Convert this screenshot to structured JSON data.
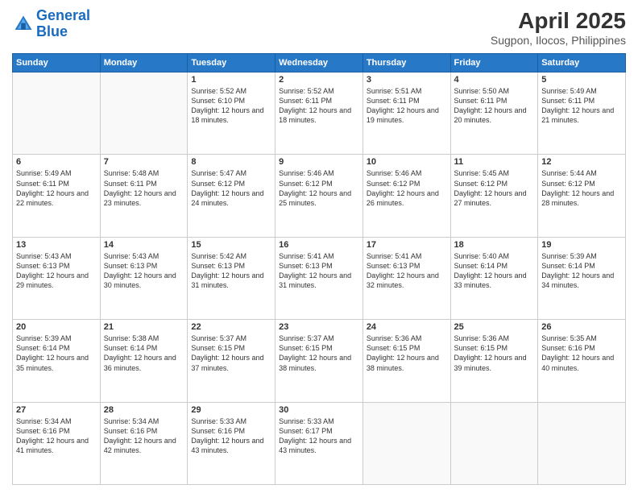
{
  "header": {
    "logo_line1": "General",
    "logo_line2": "Blue",
    "title": "April 2025",
    "subtitle": "Sugpon, Ilocos, Philippines"
  },
  "calendar": {
    "days_of_week": [
      "Sunday",
      "Monday",
      "Tuesday",
      "Wednesday",
      "Thursday",
      "Friday",
      "Saturday"
    ],
    "weeks": [
      [
        {
          "day": "",
          "sunrise": "",
          "sunset": "",
          "daylight": ""
        },
        {
          "day": "",
          "sunrise": "",
          "sunset": "",
          "daylight": ""
        },
        {
          "day": "1",
          "sunrise": "Sunrise: 5:52 AM",
          "sunset": "Sunset: 6:10 PM",
          "daylight": "Daylight: 12 hours and 18 minutes."
        },
        {
          "day": "2",
          "sunrise": "Sunrise: 5:52 AM",
          "sunset": "Sunset: 6:11 PM",
          "daylight": "Daylight: 12 hours and 18 minutes."
        },
        {
          "day": "3",
          "sunrise": "Sunrise: 5:51 AM",
          "sunset": "Sunset: 6:11 PM",
          "daylight": "Daylight: 12 hours and 19 minutes."
        },
        {
          "day": "4",
          "sunrise": "Sunrise: 5:50 AM",
          "sunset": "Sunset: 6:11 PM",
          "daylight": "Daylight: 12 hours and 20 minutes."
        },
        {
          "day": "5",
          "sunrise": "Sunrise: 5:49 AM",
          "sunset": "Sunset: 6:11 PM",
          "daylight": "Daylight: 12 hours and 21 minutes."
        }
      ],
      [
        {
          "day": "6",
          "sunrise": "Sunrise: 5:49 AM",
          "sunset": "Sunset: 6:11 PM",
          "daylight": "Daylight: 12 hours and 22 minutes."
        },
        {
          "day": "7",
          "sunrise": "Sunrise: 5:48 AM",
          "sunset": "Sunset: 6:11 PM",
          "daylight": "Daylight: 12 hours and 23 minutes."
        },
        {
          "day": "8",
          "sunrise": "Sunrise: 5:47 AM",
          "sunset": "Sunset: 6:12 PM",
          "daylight": "Daylight: 12 hours and 24 minutes."
        },
        {
          "day": "9",
          "sunrise": "Sunrise: 5:46 AM",
          "sunset": "Sunset: 6:12 PM",
          "daylight": "Daylight: 12 hours and 25 minutes."
        },
        {
          "day": "10",
          "sunrise": "Sunrise: 5:46 AM",
          "sunset": "Sunset: 6:12 PM",
          "daylight": "Daylight: 12 hours and 26 minutes."
        },
        {
          "day": "11",
          "sunrise": "Sunrise: 5:45 AM",
          "sunset": "Sunset: 6:12 PM",
          "daylight": "Daylight: 12 hours and 27 minutes."
        },
        {
          "day": "12",
          "sunrise": "Sunrise: 5:44 AM",
          "sunset": "Sunset: 6:12 PM",
          "daylight": "Daylight: 12 hours and 28 minutes."
        }
      ],
      [
        {
          "day": "13",
          "sunrise": "Sunrise: 5:43 AM",
          "sunset": "Sunset: 6:13 PM",
          "daylight": "Daylight: 12 hours and 29 minutes."
        },
        {
          "day": "14",
          "sunrise": "Sunrise: 5:43 AM",
          "sunset": "Sunset: 6:13 PM",
          "daylight": "Daylight: 12 hours and 30 minutes."
        },
        {
          "day": "15",
          "sunrise": "Sunrise: 5:42 AM",
          "sunset": "Sunset: 6:13 PM",
          "daylight": "Daylight: 12 hours and 31 minutes."
        },
        {
          "day": "16",
          "sunrise": "Sunrise: 5:41 AM",
          "sunset": "Sunset: 6:13 PM",
          "daylight": "Daylight: 12 hours and 31 minutes."
        },
        {
          "day": "17",
          "sunrise": "Sunrise: 5:41 AM",
          "sunset": "Sunset: 6:13 PM",
          "daylight": "Daylight: 12 hours and 32 minutes."
        },
        {
          "day": "18",
          "sunrise": "Sunrise: 5:40 AM",
          "sunset": "Sunset: 6:14 PM",
          "daylight": "Daylight: 12 hours and 33 minutes."
        },
        {
          "day": "19",
          "sunrise": "Sunrise: 5:39 AM",
          "sunset": "Sunset: 6:14 PM",
          "daylight": "Daylight: 12 hours and 34 minutes."
        }
      ],
      [
        {
          "day": "20",
          "sunrise": "Sunrise: 5:39 AM",
          "sunset": "Sunset: 6:14 PM",
          "daylight": "Daylight: 12 hours and 35 minutes."
        },
        {
          "day": "21",
          "sunrise": "Sunrise: 5:38 AM",
          "sunset": "Sunset: 6:14 PM",
          "daylight": "Daylight: 12 hours and 36 minutes."
        },
        {
          "day": "22",
          "sunrise": "Sunrise: 5:37 AM",
          "sunset": "Sunset: 6:15 PM",
          "daylight": "Daylight: 12 hours and 37 minutes."
        },
        {
          "day": "23",
          "sunrise": "Sunrise: 5:37 AM",
          "sunset": "Sunset: 6:15 PM",
          "daylight": "Daylight: 12 hours and 38 minutes."
        },
        {
          "day": "24",
          "sunrise": "Sunrise: 5:36 AM",
          "sunset": "Sunset: 6:15 PM",
          "daylight": "Daylight: 12 hours and 38 minutes."
        },
        {
          "day": "25",
          "sunrise": "Sunrise: 5:36 AM",
          "sunset": "Sunset: 6:15 PM",
          "daylight": "Daylight: 12 hours and 39 minutes."
        },
        {
          "day": "26",
          "sunrise": "Sunrise: 5:35 AM",
          "sunset": "Sunset: 6:16 PM",
          "daylight": "Daylight: 12 hours and 40 minutes."
        }
      ],
      [
        {
          "day": "27",
          "sunrise": "Sunrise: 5:34 AM",
          "sunset": "Sunset: 6:16 PM",
          "daylight": "Daylight: 12 hours and 41 minutes."
        },
        {
          "day": "28",
          "sunrise": "Sunrise: 5:34 AM",
          "sunset": "Sunset: 6:16 PM",
          "daylight": "Daylight: 12 hours and 42 minutes."
        },
        {
          "day": "29",
          "sunrise": "Sunrise: 5:33 AM",
          "sunset": "Sunset: 6:16 PM",
          "daylight": "Daylight: 12 hours and 43 minutes."
        },
        {
          "day": "30",
          "sunrise": "Sunrise: 5:33 AM",
          "sunset": "Sunset: 6:17 PM",
          "daylight": "Daylight: 12 hours and 43 minutes."
        },
        {
          "day": "",
          "sunrise": "",
          "sunset": "",
          "daylight": ""
        },
        {
          "day": "",
          "sunrise": "",
          "sunset": "",
          "daylight": ""
        },
        {
          "day": "",
          "sunrise": "",
          "sunset": "",
          "daylight": ""
        }
      ]
    ]
  }
}
